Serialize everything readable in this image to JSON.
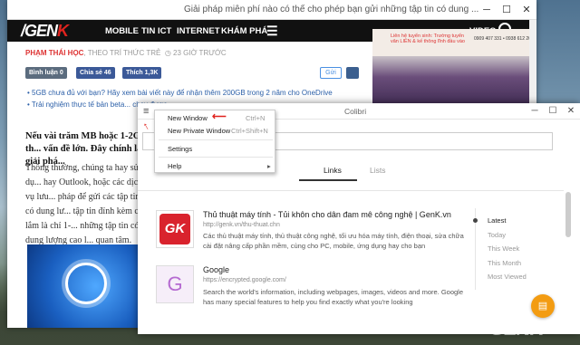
{
  "browser_back": {
    "title": "Giải pháp miễn phí nào có thể cho phép bạn gửi những tập tin có dung ...",
    "controls": {
      "minimize": "─",
      "maximize": "☐",
      "close": "✕"
    },
    "nav": {
      "logo_slash": "/",
      "logo_text": "GEN",
      "logo_k": "K",
      "items": [
        "MOBILE",
        "TIN ICT",
        "INTERNET",
        "KHÁM PHÁ"
      ],
      "video": "VIDEO"
    },
    "author": {
      "name": "PHẠM THÁI HỌC",
      "source": ", THEO TRÍ THỨC TRẺ",
      "time": "23 GIỜ TRƯỚC"
    },
    "share": {
      "comment": "Bình luận 0",
      "fb_share": "Chia sẻ 46",
      "like": "Thích 1,3K",
      "gui": "Gửi"
    },
    "bullets": [
      "5GB chưa đủ với bạn? Hãy xem bài viết này để nhận thêm 200GB trong 2 năm cho OneDrive",
      "Trải nghiệm thực tế bản beta... chạy được"
    ],
    "lead": "Nếu vài trăm MB hoặc 1-2GB th... vấn đề lớn. Đây chính là giải phá...",
    "paragraph": "Thông thường, chúng ta hay sử dụ... hay Outlook, hoặc các dịch vụ lưu... pháp để gửi các tập tin có dung lư... tập tin đính kèm cao lắm là chỉ 1-... những tập tin có dung lượng cao l... quan tâm.",
    "ad": {
      "text": "Liên hệ tuyển sinh: Trường tuyển văn LIÊN & kế thông lĩnh đầu vào",
      "phone": "0909 407 331 • 0938 612 264"
    }
  },
  "colibri": {
    "title": "Colibri",
    "controls": {
      "minimize": "─",
      "maximize": "☐",
      "close": "✕"
    },
    "menu": {
      "new_window": "New Window",
      "new_window_shortcut": "Ctrl+N",
      "new_private_window": "New Private Window",
      "new_private_shortcut": "Ctrl+Shift+N",
      "settings": "Settings",
      "help": "Help"
    },
    "tabs": {
      "links": "Links",
      "lists": "Lists"
    },
    "entries": [
      {
        "logo": "GK",
        "title": "Thủ thuật máy tính - Tủi khôn cho dân đam mê công nghệ | GenK.vn",
        "url": "http://genk.vn/thu-thuat.chn",
        "desc": "Các thủ thuật máy tính, thủ thuật công nghệ, tối ưu hóa máy tính, điện thoại, sửa chữa cài đặt nâng cấp phần mềm, cùng cho PC, mobile, ứng dụng hay cho bạn"
      },
      {
        "logo": "G",
        "title": "Google",
        "url": "https://encrypted.google.com/",
        "desc": "Search the world's information, including webpages, images, videos and more. Google has many special features to help you find exactly what you're looking"
      }
    ],
    "filters": [
      "Latest",
      "Today",
      "This Week",
      "This Month",
      "Most Viewed"
    ],
    "fab_icon": "comment-icon"
  },
  "watermark": "GENK"
}
